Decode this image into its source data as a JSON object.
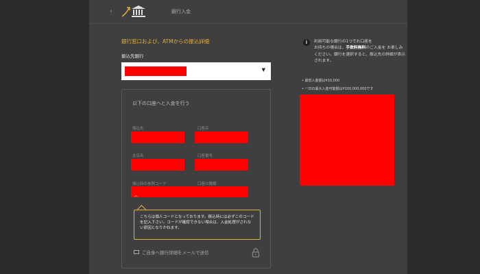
{
  "header": {
    "title": "銀行入金",
    "back_icon": "chevron-left-icon",
    "logo_icon": "bank-icon"
  },
  "form": {
    "section_title": "銀行窓口および、ATMからの振込詳細",
    "bank_label": "振込先銀行",
    "bank_value": "",
    "card": {
      "title": "以下の口座へと入金を行う",
      "fields": [
        {
          "label": "振込先",
          "value": ""
        },
        {
          "label": "口座名",
          "value": ""
        },
        {
          "label": "支店名",
          "value": ""
        },
        {
          "label": "口座番号",
          "value": ""
        },
        {
          "label": "振込時の参照コード",
          "value": ""
        },
        {
          "label": "口座の種類",
          "value": ""
        }
      ],
      "code_toggle": "^",
      "tooltip": "こちらは個人コードとなっております。振込時には必ずこのコードを記入下さい。コードが確認できない場合は、入金処理がされない原因となりかねます。",
      "email_link": "ご自身へ銀行詳細をメールで送信"
    }
  },
  "info": {
    "text_pre": "利用可能な銀行の1つでお口座を",
    "text_line2_pre": "お持ちの場合は、",
    "text_bold": "手数料無料",
    "text_line2_post": "のご入金を",
    "text_post": "お楽しみください。銀行を選択すると、振込先の詳細が表示されます。",
    "min_deposit": "• 最低入金額は¥10,000",
    "max_deposit": "• 一日の最大入金可能額は¥100,000,000です"
  },
  "colors": {
    "accent": "#e3b23c",
    "redaction": "#ff0000"
  }
}
